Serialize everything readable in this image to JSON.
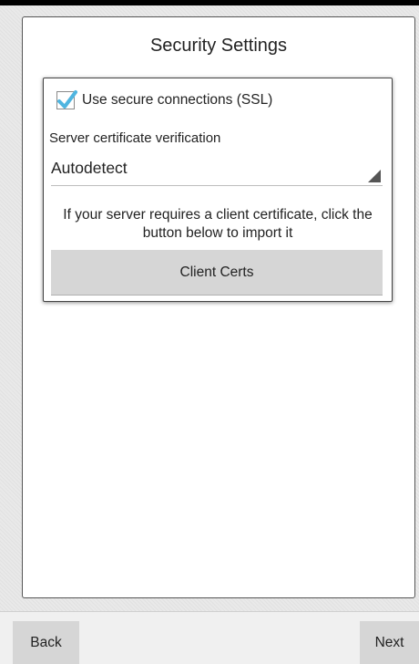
{
  "header": {
    "title": "Security Settings"
  },
  "ssl": {
    "label": "Use secure connections (SSL)",
    "checked": true
  },
  "verification": {
    "label": "Server certificate verification",
    "selected": "Autodetect"
  },
  "client_cert": {
    "help_text": "If your server requires a client certificate, click the button below to import it",
    "button_label": "Client Certs"
  },
  "nav": {
    "back_label": "Back",
    "next_label": "Next"
  },
  "colors": {
    "checkmark": "#4fb5e0",
    "button_bg": "#d6d6d6"
  }
}
